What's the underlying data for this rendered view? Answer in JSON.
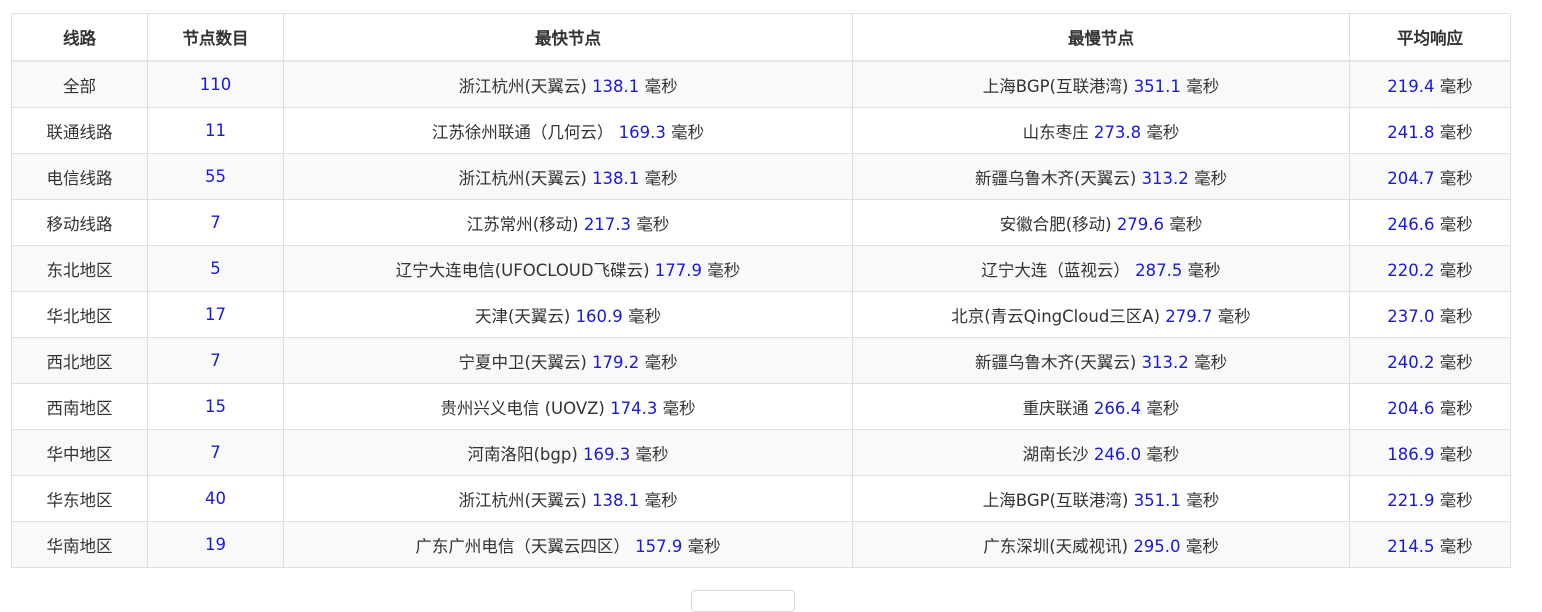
{
  "headers": [
    "线路",
    "节点数目",
    "最快节点",
    "最慢节点",
    "平均响应"
  ],
  "unit": "毫秒",
  "rows": [
    {
      "line": "全部",
      "count": "110",
      "fast_name": "浙江杭州(天翼云)",
      "fast_val": "138.1",
      "slow_name": "上海BGP(互联港湾)",
      "slow_val": "351.1",
      "avg": "219.4"
    },
    {
      "line": "联通线路",
      "count": "11",
      "fast_name": "江苏徐州联通（几何云）",
      "fast_val": "169.3",
      "slow_name": "山东枣庄",
      "slow_val": "273.8",
      "avg": "241.8"
    },
    {
      "line": "电信线路",
      "count": "55",
      "fast_name": "浙江杭州(天翼云)",
      "fast_val": "138.1",
      "slow_name": "新疆乌鲁木齐(天翼云)",
      "slow_val": "313.2",
      "avg": "204.7"
    },
    {
      "line": "移动线路",
      "count": "7",
      "fast_name": "江苏常州(移动)",
      "fast_val": "217.3",
      "slow_name": "安徽合肥(移动)",
      "slow_val": "279.6",
      "avg": "246.6"
    },
    {
      "line": "东北地区",
      "count": "5",
      "fast_name": "辽宁大连电信(UFOCLOUD飞碟云)",
      "fast_val": "177.9",
      "slow_name": "辽宁大连（蓝视云）",
      "slow_val": "287.5",
      "avg": "220.2"
    },
    {
      "line": "华北地区",
      "count": "17",
      "fast_name": "天津(天翼云)",
      "fast_val": "160.9",
      "slow_name": "北京(青云QingCloud三区A)",
      "slow_val": "279.7",
      "avg": "237.0"
    },
    {
      "line": "西北地区",
      "count": "7",
      "fast_name": "宁夏中卫(天翼云)",
      "fast_val": "179.2",
      "slow_name": "新疆乌鲁木齐(天翼云)",
      "slow_val": "313.2",
      "avg": "240.2"
    },
    {
      "line": "西南地区",
      "count": "15",
      "fast_name": "贵州兴义电信 (UOVZ)",
      "fast_val": "174.3",
      "slow_name": "重庆联通",
      "slow_val": "266.4",
      "avg": "204.6"
    },
    {
      "line": "华中地区",
      "count": "7",
      "fast_name": "河南洛阳(bgp)",
      "fast_val": "169.3",
      "slow_name": "湖南长沙",
      "slow_val": "246.0",
      "avg": "186.9"
    },
    {
      "line": "华东地区",
      "count": "40",
      "fast_name": "浙江杭州(天翼云)",
      "fast_val": "138.1",
      "slow_name": "上海BGP(互联港湾)",
      "slow_val": "351.1",
      "avg": "221.9"
    },
    {
      "line": "华南地区",
      "count": "19",
      "fast_name": "广东广州电信（天翼云四区）",
      "fast_val": "157.9",
      "slow_name": "广东深圳(天威视讯)",
      "slow_val": "295.0",
      "avg": "214.5"
    }
  ],
  "colors": {
    "value": "#1a1ad6",
    "text": "#333333",
    "border": "#e0e0e0",
    "stripe": "#f9f9f9"
  }
}
